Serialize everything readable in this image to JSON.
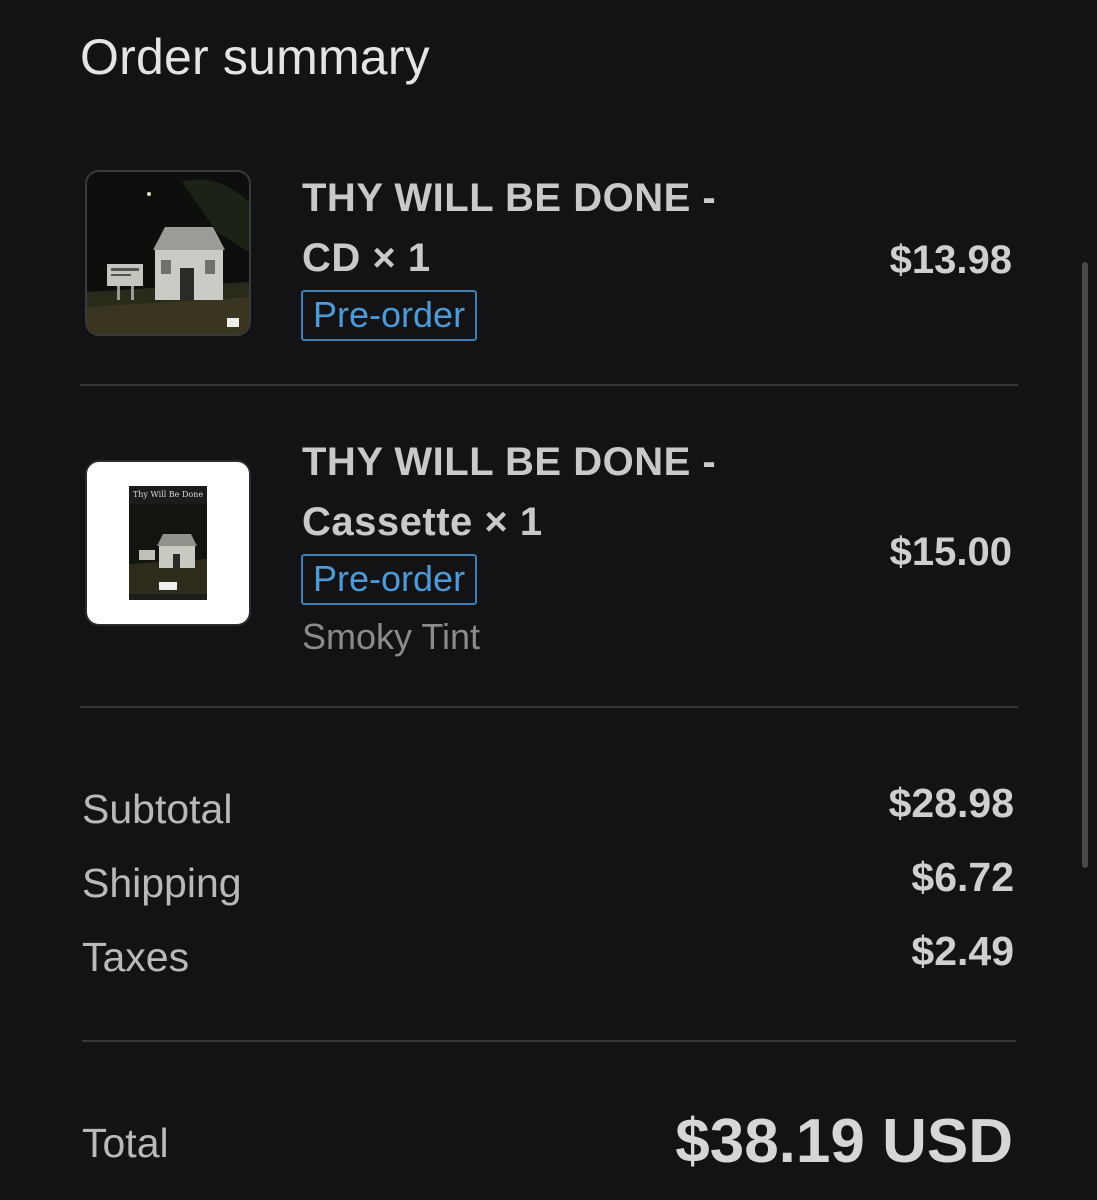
{
  "header": {
    "title": "Order summary"
  },
  "items": [
    {
      "name_line1": "THY WILL BE DONE -",
      "name_line2": "CD × 1",
      "badge": "Pre-order",
      "price": "$13.98",
      "thumb_icon": "album-cover-image"
    },
    {
      "name_line1": "THY WILL BE DONE -",
      "name_line2": "Cassette × 1",
      "badge": "Pre-order",
      "variant": "Smoky Tint",
      "price": "$15.00",
      "thumb_icon": "cassette-product-image",
      "thumb_caption": "Thy Will Be Done"
    }
  ],
  "totals": {
    "subtotal_label": "Subtotal",
    "subtotal_value": "$28.98",
    "shipping_label": "Shipping",
    "shipping_value": "$6.72",
    "taxes_label": "Taxes",
    "taxes_value": "$2.49",
    "total_label": "Total",
    "total_value": "$38.19 USD"
  },
  "colors": {
    "background": "#131315",
    "badge_accent": "#4e9ad6",
    "divider": "#37373b"
  }
}
